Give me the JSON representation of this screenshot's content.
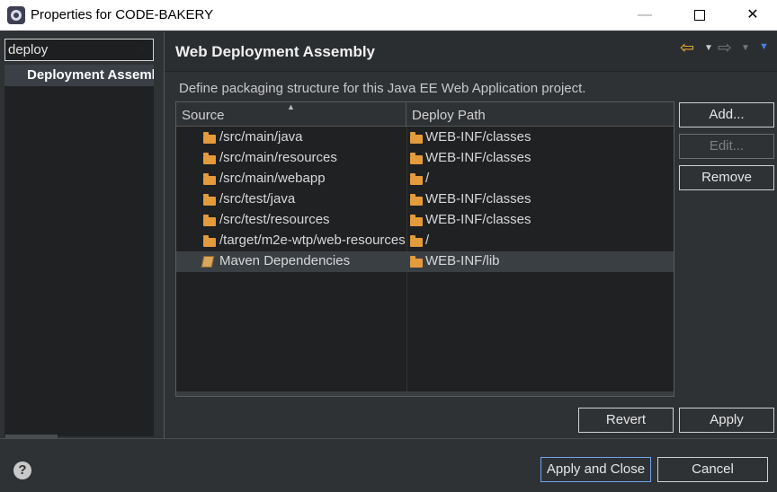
{
  "window": {
    "title": "Properties for CODE-BAKERY",
    "minimize_glyph": "—",
    "close_glyph": "✕"
  },
  "filter": {
    "value": "deploy",
    "clear_glyph": "✕"
  },
  "tree": {
    "items": [
      {
        "label": "Deployment Assembly"
      }
    ]
  },
  "page": {
    "title": "Web Deployment Assembly",
    "description": "Define packaging structure for this Java EE Web Application project.",
    "nav": {
      "back_glyph": "⇦",
      "forward_glyph": "⇨",
      "dropdown_glyph": "▼",
      "menu_glyph": "▼"
    }
  },
  "table": {
    "columns": {
      "source": "Source",
      "deploy_path": "Deploy Path"
    },
    "sort_glyph": "▲",
    "rows": [
      {
        "source": "/src/main/java",
        "path": "WEB-INF/classes",
        "source_icon": "folder-icon"
      },
      {
        "source": "/src/main/resources",
        "path": "WEB-INF/classes",
        "source_icon": "folder-icon"
      },
      {
        "source": "/src/main/webapp",
        "path": "/",
        "source_icon": "folder-icon"
      },
      {
        "source": "/src/test/java",
        "path": "WEB-INF/classes",
        "source_icon": "folder-icon"
      },
      {
        "source": "/src/test/resources",
        "path": "WEB-INF/classes",
        "source_icon": "folder-icon"
      },
      {
        "source": "/target/m2e-wtp/web-resources",
        "path": "/",
        "source_icon": "folder-icon"
      },
      {
        "source": "Maven Dependencies",
        "path": "WEB-INF/lib",
        "source_icon": "library-icon",
        "selected": true
      }
    ]
  },
  "buttons": {
    "add": "Add...",
    "edit": "Edit...",
    "remove": "Remove",
    "revert": "Revert",
    "apply": "Apply",
    "apply_and_close": "Apply and Close",
    "cancel": "Cancel"
  },
  "help": {
    "glyph": "?"
  },
  "colors": {
    "accent_nav": "#f2b630",
    "folder": "#e39b3c",
    "primary_border": "#6fa3ef"
  }
}
